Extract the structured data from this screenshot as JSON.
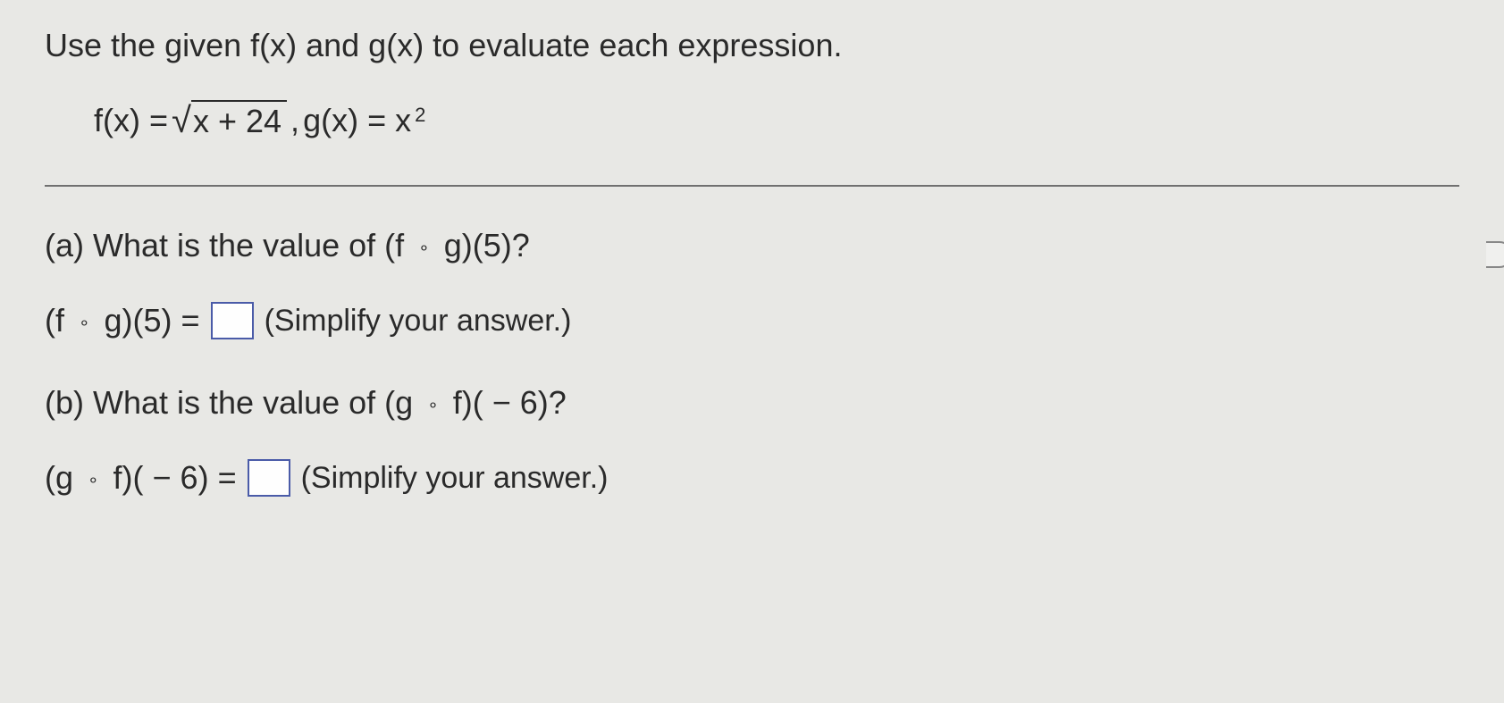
{
  "problem": {
    "instruction": "Use the given f(x) and g(x) to evaluate each expression.",
    "f_label": "f(x) = ",
    "f_body_sqrt": "x + 24",
    "separator": " , ",
    "g_label": "g(x) = x",
    "g_exp": "2"
  },
  "part_a": {
    "prompt_prefix": "(a) What is the value of (f ",
    "prompt_mid": " g)(5)?",
    "answer_prefix": "(f ",
    "answer_mid": " g)(5) = ",
    "hint": "(Simplify your answer.)"
  },
  "part_b": {
    "prompt_prefix": "(b) What is the value of (g ",
    "prompt_mid": " f)( − 6)?",
    "answer_prefix": "(g ",
    "answer_mid": " f)( − 6) = ",
    "hint": "(Simplify your answer.)"
  },
  "symbols": {
    "compose": "∘"
  }
}
